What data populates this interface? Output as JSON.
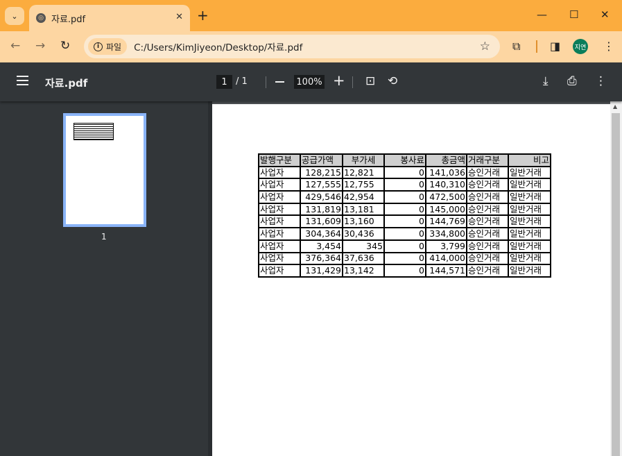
{
  "browser": {
    "tab_title": "자료.pdf",
    "url": "C:/Users/KimJiyeon/Desktop/자료.pdf",
    "chip_label": "파일",
    "profile_initials": "지연"
  },
  "pdf": {
    "filename": "자료.pdf",
    "current_page": "1",
    "total_pages": "/ 1",
    "zoom": "100%",
    "thumbnail_label": "1"
  },
  "table": {
    "headers": [
      "발행구분",
      "공급가액",
      "부가세",
      "봉사료",
      "총금액",
      "거래구분",
      "비고"
    ],
    "rows": [
      [
        "사업자",
        "128,215",
        "12,821",
        "0",
        "141,036",
        "승인거래",
        "일반거래"
      ],
      [
        "사업자",
        "127,555",
        "12,755",
        "0",
        "140,310",
        "승인거래",
        "일반거래"
      ],
      [
        "사업자",
        "429,546",
        "42,954",
        "0",
        "472,500",
        "승인거래",
        "일반거래"
      ],
      [
        "사업자",
        "131,819",
        "13,181",
        "0",
        "145,000",
        "승인거래",
        "일반거래"
      ],
      [
        "사업자",
        "131,609",
        "13,160",
        "0",
        "144,769",
        "승인거래",
        "일반거래"
      ],
      [
        "사업자",
        "304,364",
        "30,436",
        "0",
        "334,800",
        "승인거래",
        "일반거래"
      ],
      [
        "사업자",
        "3,454",
        "345",
        "0",
        "3,799",
        "승인거래",
        "일반거래"
      ],
      [
        "사업자",
        "376,364",
        "37,636",
        "0",
        "414,000",
        "승인거래",
        "일반거래"
      ],
      [
        "사업자",
        "131,429",
        "13,142",
        "0",
        "144,571",
        "승인거래",
        "일반거래"
      ]
    ]
  }
}
